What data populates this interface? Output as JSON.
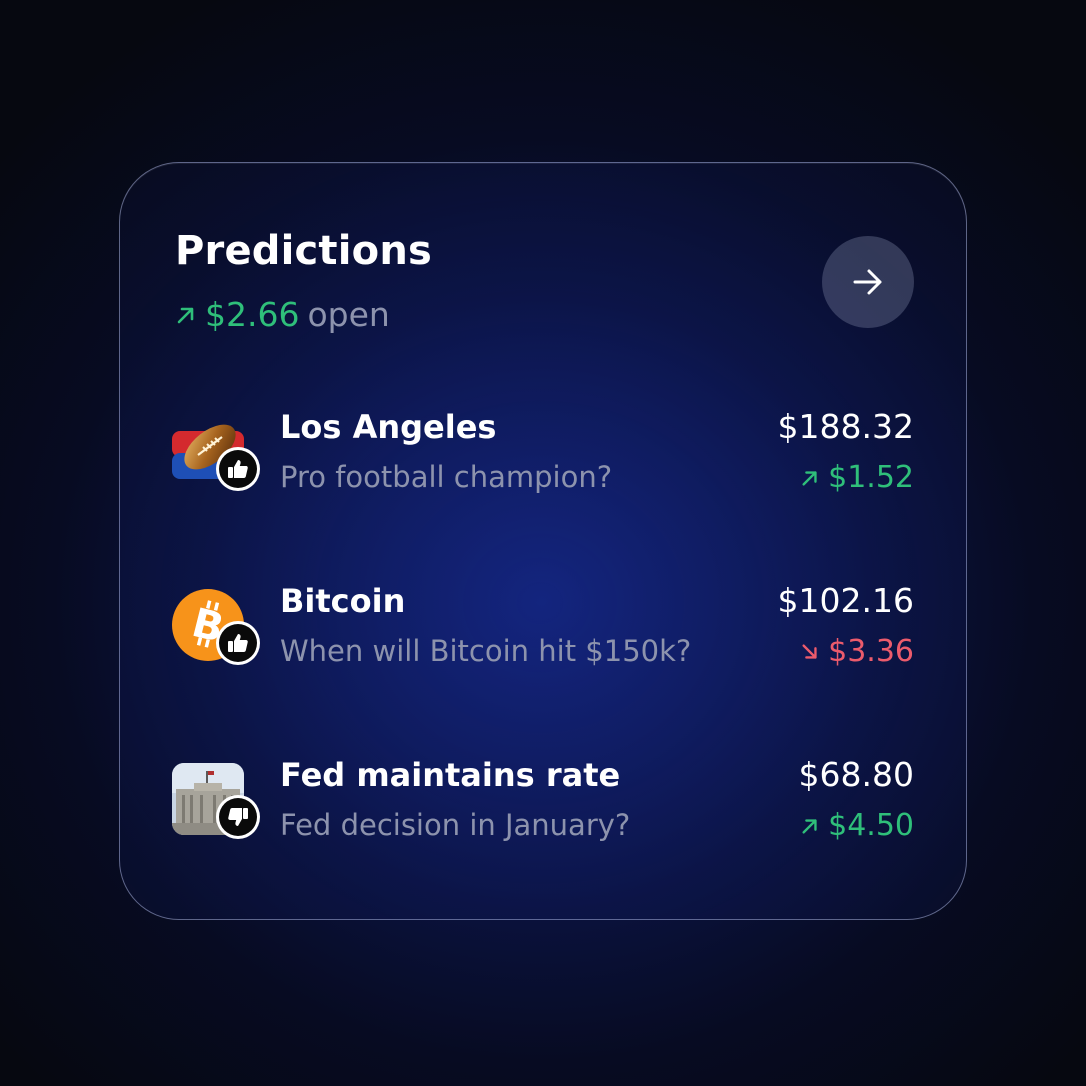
{
  "header": {
    "title": "Predictions",
    "open_amount": "$2.66",
    "open_label": "open",
    "open_trend_icon": "arrow-up-right-icon",
    "nav_icon": "arrow-right-icon"
  },
  "colors": {
    "up": "#2fbf7a",
    "down": "#ec5b6c",
    "muted": "#8d93ad"
  },
  "predictions": [
    {
      "title": "Los Angeles",
      "question": "Pro football champion?",
      "value": "$188.32",
      "change": "$1.52",
      "trend": "up",
      "vote": "thumbs-up",
      "thumb_icon": "football-icon"
    },
    {
      "title": "Bitcoin",
      "question": "When will Bitcoin hit $150k?",
      "value": "$102.16",
      "change": "$3.36",
      "trend": "down",
      "vote": "thumbs-up",
      "thumb_icon": "bitcoin-icon"
    },
    {
      "title": "Fed maintains rate",
      "question": "Fed decision in January?",
      "value": "$68.80",
      "change": "$4.50",
      "trend": "up",
      "vote": "thumbs-down",
      "thumb_icon": "federal-reserve-building-icon"
    }
  ]
}
